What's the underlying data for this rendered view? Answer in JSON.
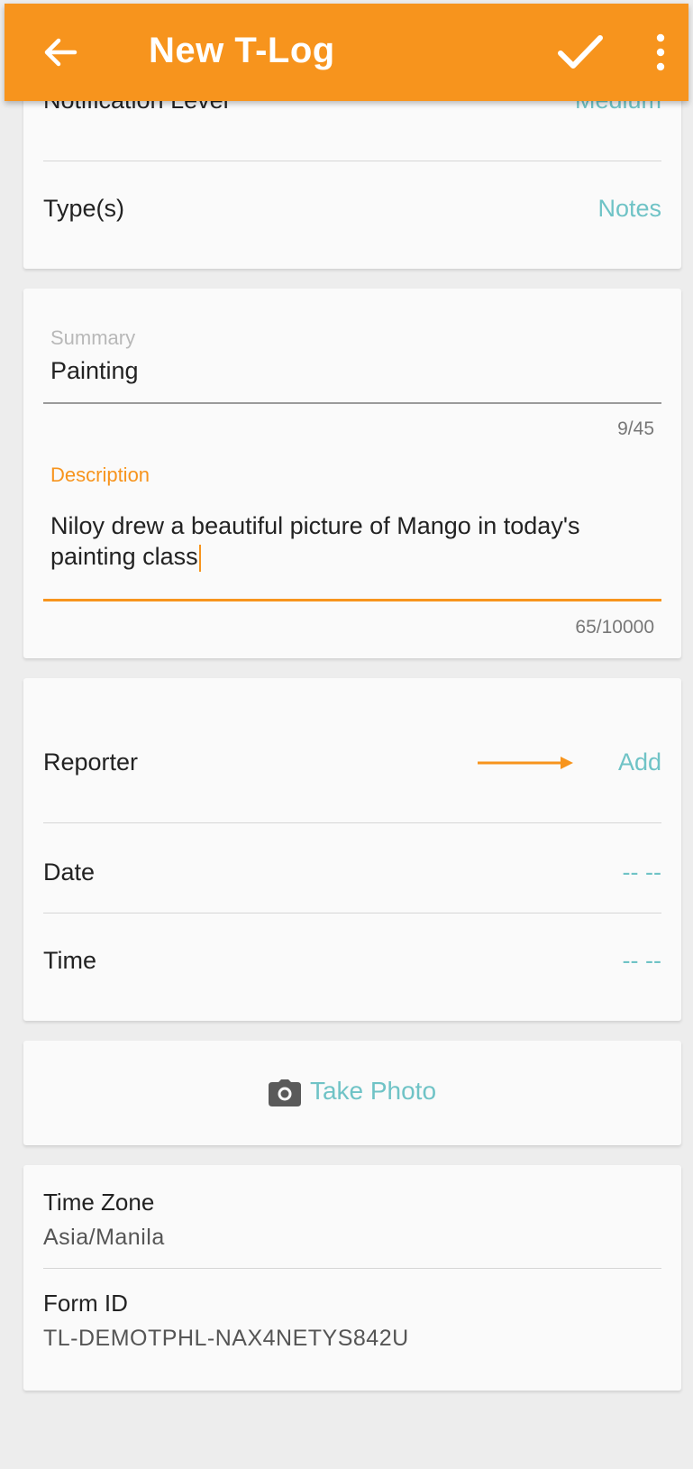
{
  "appbar": {
    "title": "New T-Log"
  },
  "card1": {
    "notification_label": "Notification Level",
    "notification_value": "Medium",
    "types_label": "Type(s)",
    "types_value": "Notes"
  },
  "card2": {
    "summary_label": "Summary",
    "summary_value": "Painting",
    "summary_counter": "9/45",
    "description_label": "Description",
    "description_line1": "Niloy drew a beautiful picture of Mango in today's",
    "description_line2": "painting class",
    "description_counter": "65/10000"
  },
  "card3": {
    "reporter_label": "Reporter",
    "reporter_value": "Add",
    "date_label": "Date",
    "date_value": "-- --",
    "time_label": "Time",
    "time_value": "-- --"
  },
  "photo": {
    "label": "Take Photo"
  },
  "info": {
    "timezone_label": "Time Zone",
    "timezone_value": "Asia/Manila",
    "formid_label": "Form ID",
    "formid_value": "TL-DEMOTPHL-NAX4NETYS842U"
  },
  "colors": {
    "accent": "#f7941d",
    "link": "#6fc3c6"
  }
}
